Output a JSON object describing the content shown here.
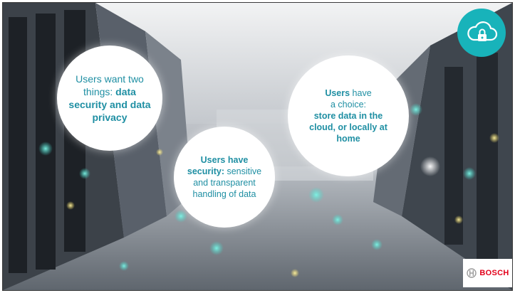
{
  "circles": {
    "left": {
      "line1": "Users want two",
      "line2_plain": "things: ",
      "line2_bold": "data",
      "line3_bold": "security and data",
      "line4_bold": "privacy"
    },
    "middle": {
      "line1_bold": "Users have",
      "line2_bold": "security:",
      "line2_plain": " sensitive",
      "line3": "and transparent",
      "line4": "handling of data"
    },
    "right": {
      "line1_bold": "Users",
      "line1_plain": " have",
      "line2": "a choice:",
      "line3_bold": "store data in the",
      "line4_bold": "cloud,  or locally at",
      "line5_bold": "home"
    }
  },
  "badge": {
    "icon": "cloud-lock-icon",
    "color": "#18b3ba"
  },
  "brand": {
    "logo_text": "BOSCH",
    "color": "#e2001a"
  },
  "colors": {
    "text_teal": "#1f8fa3",
    "glow_teal": "#3fd6c8"
  }
}
